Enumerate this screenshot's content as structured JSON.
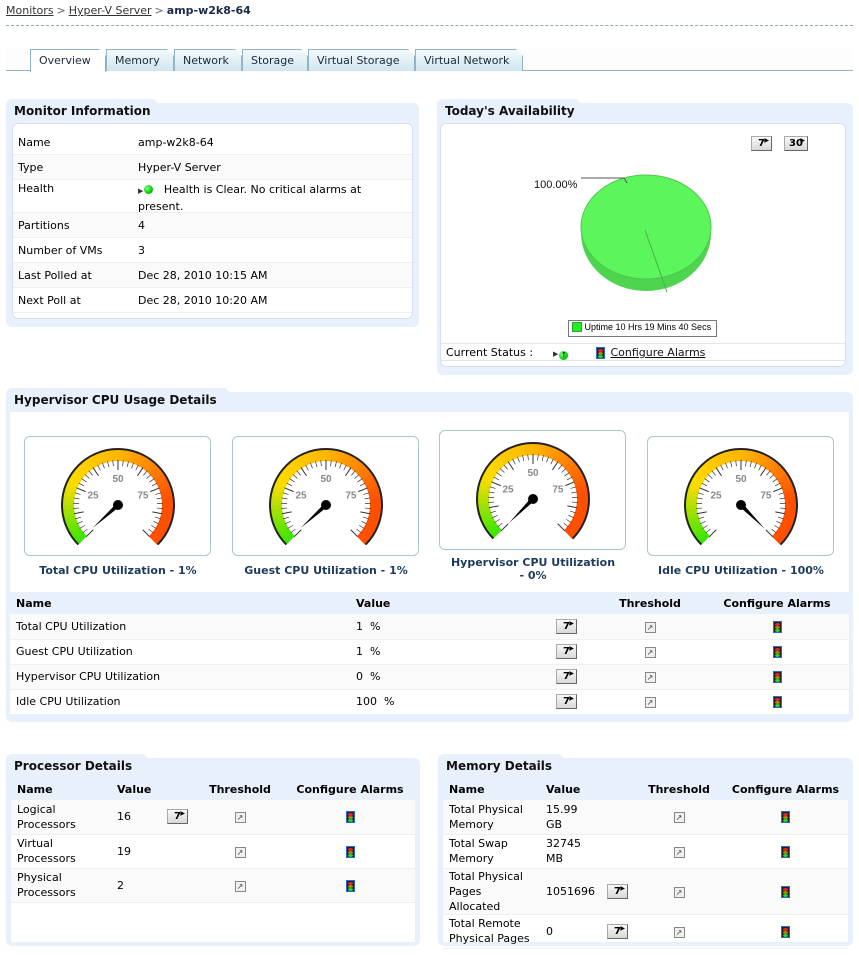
{
  "breadcrumb": {
    "items": [
      "Monitors",
      "Hyper-V Server"
    ],
    "current": "amp-w2k8-64",
    "separator": ">"
  },
  "tabs": [
    {
      "label": "Overview",
      "active": true
    },
    {
      "label": "Memory"
    },
    {
      "label": "Network"
    },
    {
      "label": "Storage"
    },
    {
      "label": "Virtual Storage"
    },
    {
      "label": "Virtual Network"
    }
  ],
  "monitor_info": {
    "title": "Monitor Information",
    "rows": [
      {
        "key": "Name",
        "value": "amp-w2k8-64"
      },
      {
        "key": "Type",
        "value": "Hyper-V Server"
      },
      {
        "key": "Health",
        "value": "Health is Clear. No critical alarms at present."
      },
      {
        "key": "Partitions",
        "value": "4"
      },
      {
        "key": "Number of VMs",
        "value": "3"
      },
      {
        "key": "Last Polled at",
        "value": "Dec 28, 2010 10:15 AM"
      },
      {
        "key": "Next Poll at",
        "value": "Dec 28, 2010 10:20 AM"
      }
    ]
  },
  "availability": {
    "title": "Today's Availability",
    "btn_7": "7",
    "btn_30": "30",
    "pie_label": "100.00%",
    "legend": "Uptime 10 Hrs 19 Mins 40 Secs",
    "current_status_label": "Current Status :",
    "configure_alarms": "Configure Alarms",
    "colors": {
      "uptime": "#5cf55c"
    }
  },
  "chart_data": {
    "type": "pie",
    "title": "Today's Availability",
    "categories": [
      "Uptime"
    ],
    "values": [
      100.0
    ],
    "labels": [
      "100.00%"
    ],
    "legend": [
      "Uptime 10 Hrs 19 Mins 40 Secs"
    ],
    "legend_placement": "bottom"
  },
  "cpu": {
    "title": "Hypervisor CPU Usage Details",
    "gauges": [
      {
        "label": "Total CPU Utilization - 1%",
        "value": 1
      },
      {
        "label": "Guest CPU Utilization - 1%",
        "value": 1
      },
      {
        "label": "Hypervisor CPU Utilization - 0%",
        "value": 0
      },
      {
        "label": "Idle CPU Utilization - 100%",
        "value": 100
      }
    ],
    "gauge_ticks": [
      "25",
      "50",
      "75"
    ],
    "headers": [
      "Name",
      "Value",
      "",
      "Threshold",
      "Configure Alarms"
    ],
    "rows": [
      {
        "name": "Total CPU Utilization",
        "value": "1  %"
      },
      {
        "name": "Guest CPU Utilization",
        "value": "1  %"
      },
      {
        "name": "Hypervisor CPU Utilization",
        "value": "0  %"
      },
      {
        "name": "Idle CPU Utilization",
        "value": "100  %"
      }
    ],
    "btn": "7"
  },
  "processor": {
    "title": "Processor Details",
    "headers": [
      "Name",
      "Value",
      "",
      "Threshold",
      "Configure Alarms"
    ],
    "rows": [
      {
        "name": "Logical Processors",
        "value": "16",
        "has_btn": true
      },
      {
        "name": "Virtual Processors",
        "value": "19",
        "has_btn": false
      },
      {
        "name": "Physical Processors",
        "value": "2",
        "has_btn": false
      }
    ],
    "btn": "7"
  },
  "memory": {
    "title": "Memory Details",
    "headers": [
      "Name",
      "Value",
      "",
      "Threshold",
      "Configure Alarms"
    ],
    "rows": [
      {
        "name": "Total Physical Memory",
        "value": "15.99 GB",
        "has_btn": false
      },
      {
        "name": "Total Swap Memory",
        "value": "32745 MB",
        "has_btn": false
      },
      {
        "name": "Total Physical Pages Allocated",
        "value": "1051696",
        "has_btn": true
      },
      {
        "name": "Total Remote Physical Pages",
        "value": "0",
        "has_btn": true
      }
    ],
    "btn": "7"
  }
}
